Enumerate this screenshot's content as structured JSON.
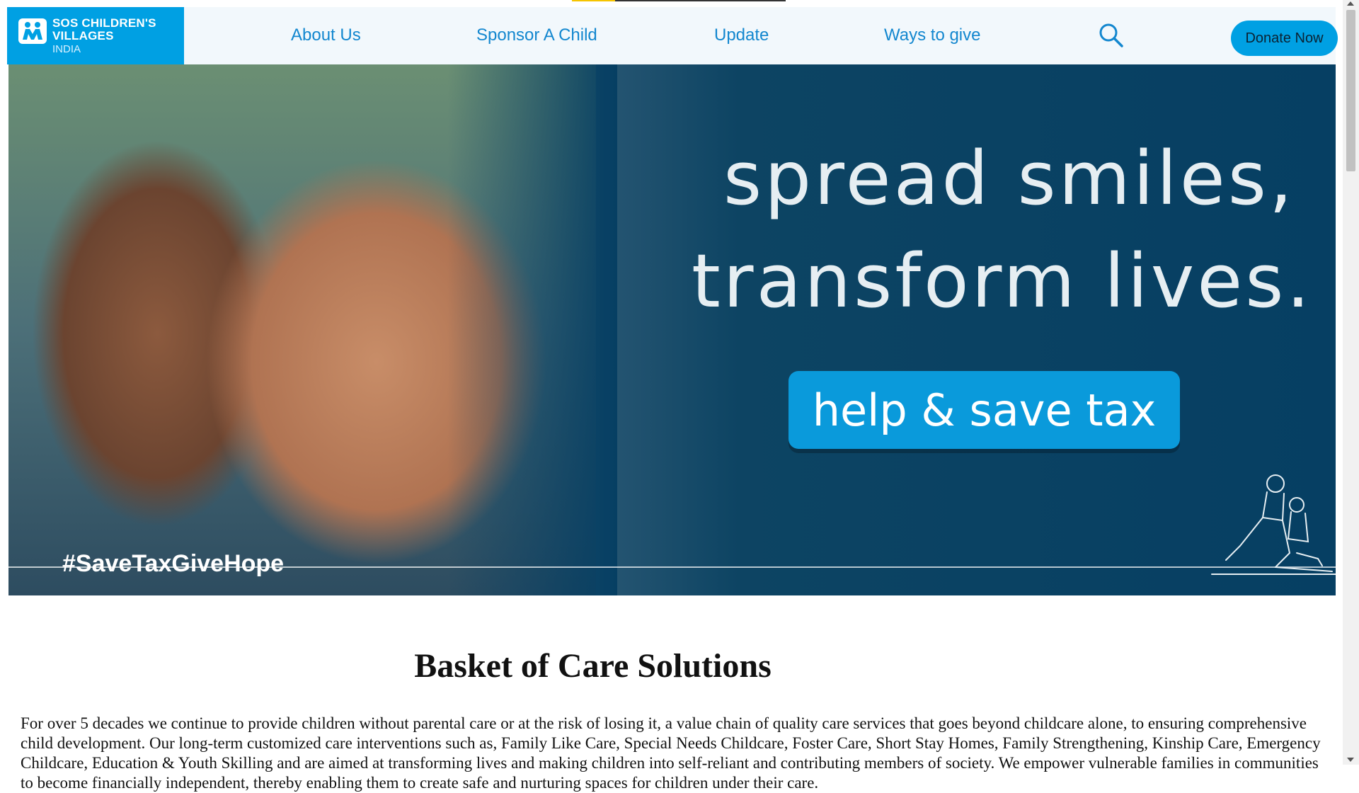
{
  "header": {
    "logo": {
      "line1": "SOS CHILDREN'S",
      "line2": "VILLAGES",
      "line3": "INDIA",
      "icon": "sos-children-logo-icon"
    },
    "nav": [
      {
        "label": "About Us"
      },
      {
        "label": "Sponsor A Child"
      },
      {
        "label": "Update"
      },
      {
        "label": "Ways to give"
      }
    ],
    "search_icon": "search-icon",
    "donate_label": "Donate Now"
  },
  "hero": {
    "title_line1": "spread smiles,",
    "title_line2": "transform lives.",
    "cta_label": "help & save tax",
    "hashtag": "#SaveTaxGiveHope"
  },
  "content": {
    "title": "Basket of Care Solutions",
    "body": "For over 5 decades we continue to provide children without parental care or at the risk of losing it, a value chain of quality care services that goes beyond childcare alone, to ensuring comprehensive child development. Our long-term customized care interventions such as, Family Like Care, Special Needs Childcare, Foster Care, Short Stay Homes, Family Strengthening, Kinship Care, Emergency Childcare, Education & Youth Skilling and are aimed at transforming lives and making children into self-reliant and contributing members of society. We empower vulnerable families in communities to become financially independent, thereby enabling them to create safe and nurturing spaces for children under their care."
  },
  "colors": {
    "brand_blue": "#00a0e3",
    "nav_text": "#1387cf",
    "hero_bg": "#063f63"
  }
}
